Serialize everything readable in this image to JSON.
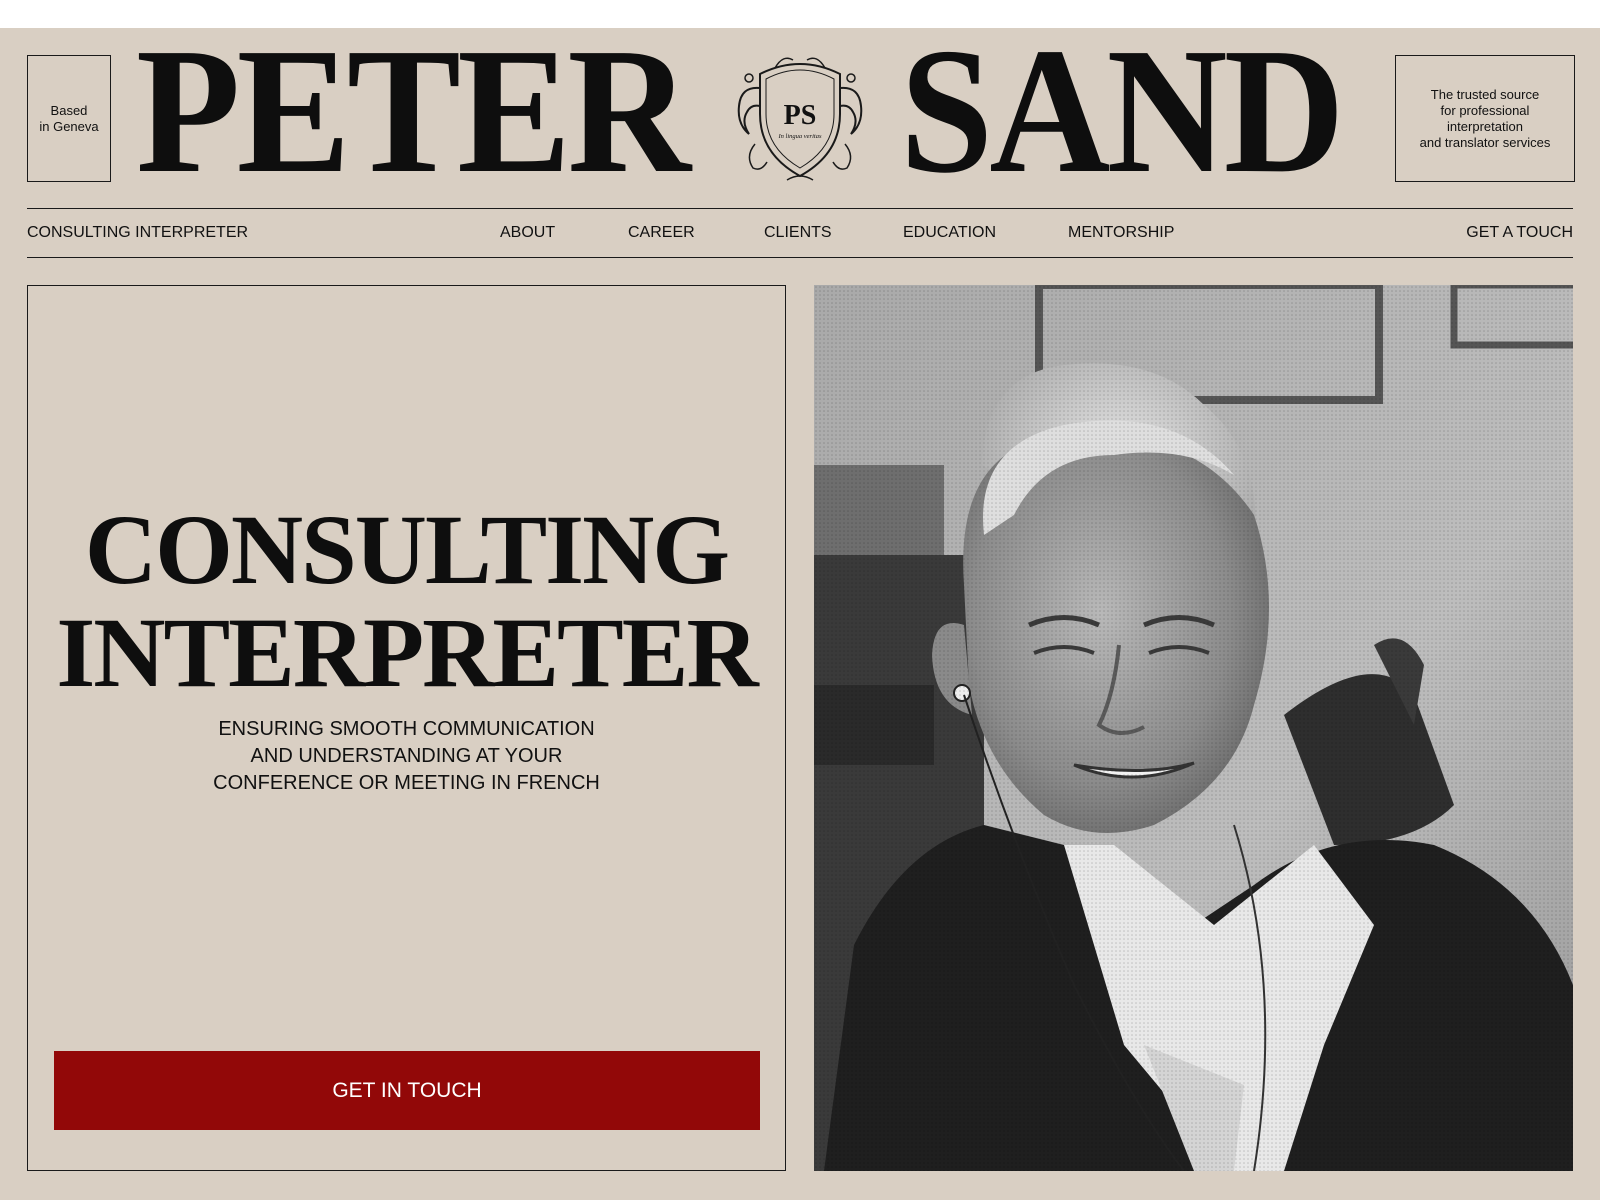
{
  "masthead": {
    "left_box": {
      "line1": "Based",
      "line2": "in Geneva"
    },
    "name_first": "PETER",
    "name_last": "SAND",
    "crest": {
      "monogram": "PS",
      "motto": "In lingua veritas"
    },
    "right_box": {
      "line1": "The trusted source",
      "line2": "for professional",
      "line3": "interpretation",
      "line4": "and translator services"
    }
  },
  "nav": {
    "brand": "CONSULTING INTERPRETER",
    "items": [
      "ABOUT",
      "CAREER",
      "CLIENTS",
      "EDUCATION",
      "MENTORSHIP"
    ],
    "contact": "GET A TOUCH"
  },
  "hero": {
    "title_line1": "CONSULTING",
    "title_line2": "INTERPRETER",
    "subtitle_line1": "ENSURING SMOOTH COMMUNICATION",
    "subtitle_line2": "AND UNDERSTANDING AT YOUR",
    "subtitle_line3": "CONFERENCE OR MEETING IN FRENCH",
    "cta_label": "GET IN TOUCH"
  },
  "colors": {
    "background": "#d9cfc3",
    "ink": "#111111",
    "accent": "#920808"
  }
}
